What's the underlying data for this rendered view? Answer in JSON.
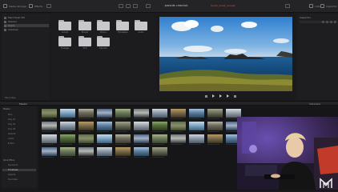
{
  "topbar": {
    "left_button_1": "Media Storage",
    "left_button_2": "Effects",
    "project_title": "provide cineclub",
    "clip_name": "South_Coast_Sunset",
    "right_button_1": "Lists",
    "right_button_2": "Inspector"
  },
  "media_tree": {
    "items": [
      "Macintosh HD",
      "Shared",
      "Users",
      "Volumes"
    ],
    "footer": "Favorites"
  },
  "folders": {
    "items": [
      {
        "label": "A-Cam"
      },
      {
        "label": "B-Cam"
      },
      {
        "label": "Drone"
      },
      {
        "label": "Timelapse"
      },
      {
        "label": "Audio"
      },
      {
        "label": "Footage"
      },
      {
        "label": "GFX"
      },
      {
        "label": "Exports"
      }
    ]
  },
  "viewer": {
    "fit_label": "Fit",
    "timecode": "01:00:12:08"
  },
  "inspector": {
    "title": "Inspector"
  },
  "media_pool": {
    "label": "Master",
    "right_label": "Metadata",
    "sidebar_header": "Master",
    "sidebar_items": [
      "Bins",
      "Day 01",
      "Day 02",
      "Day 03",
      "Selects",
      "Audio",
      "B-Roll"
    ],
    "smart_header": "Smart Bins",
    "smart_items": [
      "Keywords",
      "Timelines",
      "Selects",
      "Favorites"
    ]
  },
  "colors": {
    "background": "#1a1a1c",
    "panel": "#1e1e20",
    "accent_clip": "#d6523a",
    "cam_light": "#7b5bd1"
  },
  "logo": {
    "name": "brand-logo"
  }
}
